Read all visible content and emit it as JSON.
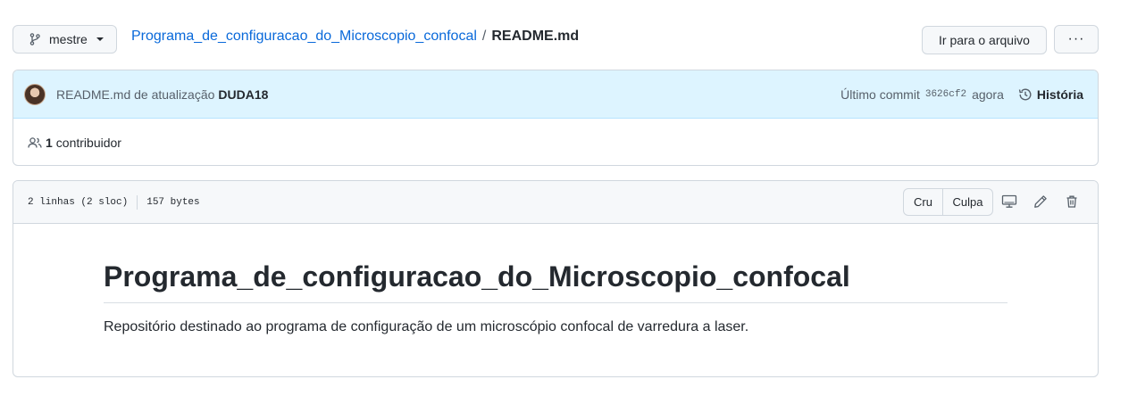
{
  "branch": {
    "name": "mestre",
    "icon": "git-branch-icon"
  },
  "breadcrumb": {
    "repo": "Programa_de_configuracao_do_Microscopio_confocal",
    "separator": "/",
    "file": "README.md"
  },
  "actions": {
    "goto_file": "Ir para o arquivo",
    "more": "···"
  },
  "commit": {
    "message": "README.md de atualização",
    "author": "DUDA18",
    "last_commit_label": "Último commit",
    "sha": "3626cf2",
    "time": "agora",
    "history_label": "História"
  },
  "contributors": {
    "count": "1",
    "label": "contribuidor"
  },
  "file": {
    "lines": "2 linhas (2 sloc)",
    "size": "157 bytes",
    "raw_label": "Cru",
    "blame_label": "Culpa"
  },
  "readme": {
    "heading": "Programa_de_configuracao_do_Microscopio_confocal",
    "paragraph": "Repositório destinado ao programa de configuração de um microscópio confocal de varredura a laser."
  },
  "colors": {
    "link": "#0969da",
    "commit_bar": "#ddf4ff",
    "border": "#d0d7de"
  }
}
